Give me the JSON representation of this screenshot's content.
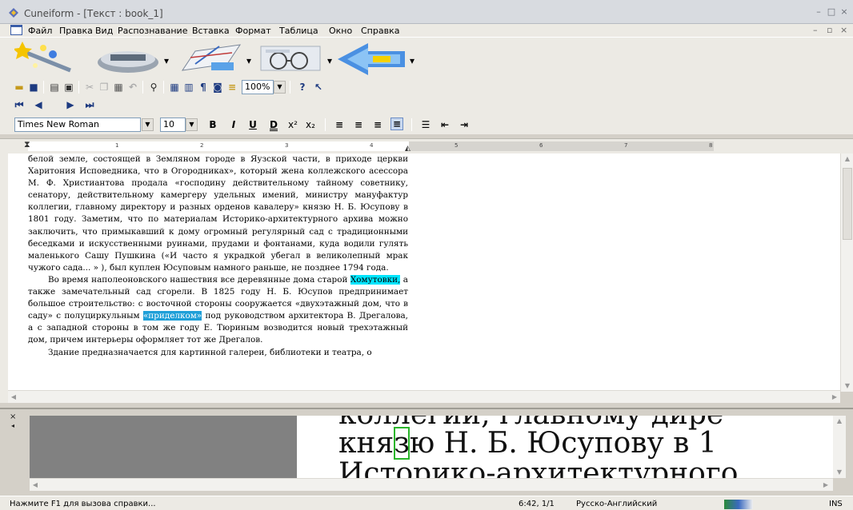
{
  "window": {
    "title": "Cuneiform - [Текст : book_1]"
  },
  "menu": {
    "items": [
      "Файл",
      "Правка",
      "Вид",
      "Распознавание",
      "Вставка",
      "Формат",
      "Таблица",
      "Окно",
      "Справка"
    ]
  },
  "toolbar": {
    "font_name": "Times New Roman",
    "font_size": "10",
    "zoom": "100%",
    "bold": "B",
    "italic": "I",
    "underline": "U",
    "double_underline": "D",
    "superscript": "x²",
    "subscript": "x₂"
  },
  "ruler": {
    "numbers": [
      "1",
      "2",
      "3",
      "4",
      "5",
      "6",
      "7",
      "8"
    ]
  },
  "document": {
    "p1": "белой земле, состоящей в Земляном городе в Яузской части, в приходе церкви Харитония Исповедника, что в Огородниках», который жена коллежского асессора М. Ф. Христиантова продала «господину действительному тайному советнику, сенатору, действительному камергеру удельных имений, министру мануфактур коллегии, главному директору и разных орденов кавалеру» князю Н. Б. Юсупову в 1801 году. Заметим, что по материалам Историко-архитектурного архива можно заключить, что примыкавший к дому огромный регулярный сад с традиционными беседками и искусственными руинами, прудами и фонтанами, куда водили гулять маленького Сашу Пушкина («И часто я украдкой убегал в великолепный мрак чужого сада... » ), был куплен Юсуповым намного раньше, не позднее 1794 года.",
    "p2_start": "Во время наполеоновского нашествия все деревянные дома старой ",
    "p2_hl": "Хомутовки,",
    "p2_mid": " а также замечательный сад сгорели. В 1825 году Н. Б. Юсупов предпринимает большое строительство: с восточной стороны сооружается «двухэтажный дом, что в саду» с полуциркульным ",
    "p2_hl2": "«приделком»",
    "p2_end": " под руководством архитектора В. Дрегалова, а с западной стороны в том же году Е. Тюриным возводится новый трехэтажный дом, причем интерьеры оформляет тот же Дрегалов.",
    "p3": "Здание предназначается для картинной галереи, библиотеки и театра, о"
  },
  "zoom_image": {
    "line1": "коллегии, главному дире",
    "line2_a": "кня",
    "line2_box": "з",
    "line2_b": "ю Н. Б. Юсупову в 1",
    "line3": "Историко-архитектурного"
  },
  "status": {
    "hint": "Нажмите F1 для вызова справки...",
    "position": "6:42, 1/1",
    "language": "Русско-Английский",
    "mode": "INS"
  },
  "colors": {
    "highlight_cyan": "#00e5ff",
    "highlight_selected": "#1f9fd8",
    "char_box": "#2bb52b"
  }
}
